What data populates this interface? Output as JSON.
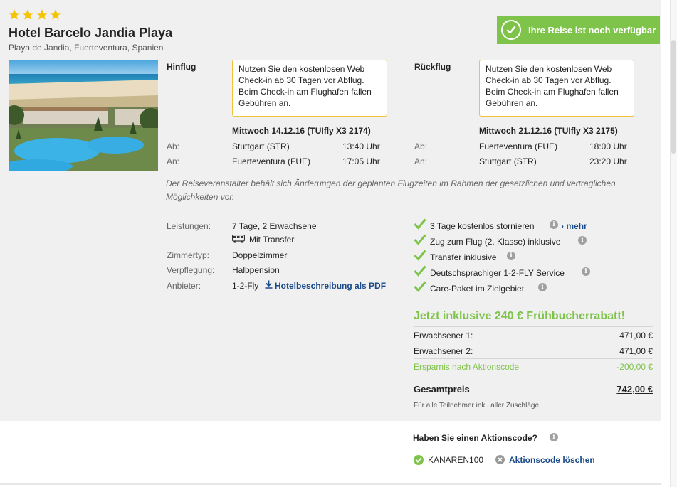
{
  "hotel": {
    "stars": 4,
    "name": "Hotel Barcelo Jandia Playa",
    "location": "Playa de Jandia, Fuerteventura, Spanien"
  },
  "availability": {
    "text": "Ihre Reise ist noch verfügbar",
    "icon": "check-circle-icon"
  },
  "outbound": {
    "heading": "Hinflug",
    "notice": "Nutzen Sie den kostenlosen Web Check-in ab 30 Tagen vor Abflug. Beim Check-in am Flughafen fallen Gebühren an.",
    "date_flight": "Mittwoch 14.12.16 (TUIfly X3 2174)",
    "from_label": "Ab:",
    "from_airport": "Stuttgart (STR)",
    "from_time": "13:40 Uhr",
    "to_label": "An:",
    "to_airport": "Fuerteventura (FUE)",
    "to_time": "17:05 Uhr"
  },
  "return": {
    "heading": "Rückflug",
    "notice": "Nutzen Sie den kostenlosen Web Check-in ab 30 Tagen vor Abflug. Beim Check-in am Flughafen fallen Gebühren an.",
    "date_flight": "Mittwoch 21.12.16 (TUIfly X3 2175)",
    "from_label": "Ab:",
    "from_airport": "Fuerteventura (FUE)",
    "from_time": "18:00 Uhr",
    "to_label": "An:",
    "to_airport": "Stuttgart (STR)",
    "to_time": "23:20 Uhr"
  },
  "disclaimer": "Der Reiseveranstalter behält sich Änderungen der geplanten Flugzeiten im Rahmen der gesetzlichen und vertraglichen Möglichkeiten vor.",
  "details": {
    "services_label": "Leistungen:",
    "services_value": "7 Tage, 2 Erwachsene",
    "transfer": "Mit Transfer",
    "room_label": "Zimmertyp:",
    "room_value": "Doppelzimmer",
    "board_label": "Verpflegung:",
    "board_value": "Halbpension",
    "provider_label": "Anbieter:",
    "provider_value": "1-2-Fly",
    "pdf_link": "Hotelbeschreibung als PDF"
  },
  "features": [
    {
      "text": "3 Tage kostenlos stornieren"
    },
    {
      "text": "Zug zum Flug (2. Klasse) inklusive"
    },
    {
      "text": "Transfer inklusive"
    },
    {
      "text": "Deutschsprachiger 1-2-FLY Service"
    },
    {
      "text": "Care-Paket im Zielgebiet"
    }
  ],
  "more_link": "mehr",
  "pricing": {
    "headline": "Jetzt inklusive 240 € Frühbucherrabatt!",
    "adult1_label": "Erwachsener 1:",
    "adult1_value": "471,00 €",
    "adult2_label": "Erwachsener 2:",
    "adult2_value": "471,00 €",
    "savings_label": "Ersparnis nach Aktionscode",
    "savings_value": "-200,00 €",
    "total_label": "Gesamtpreis",
    "total_value": "742,00 €",
    "total_note": "Für alle Teilnehmer inkl. aller Zuschläge"
  },
  "promo": {
    "question": "Haben Sie einen Aktionscode?",
    "code": "KANAREN100",
    "delete_label": "Aktionscode löschen"
  },
  "colors": {
    "accent_green": "#7ec34a",
    "notice_border": "#f2c23a",
    "link_blue": "#1a4a8a",
    "panel_bg": "#f0f0f0"
  }
}
